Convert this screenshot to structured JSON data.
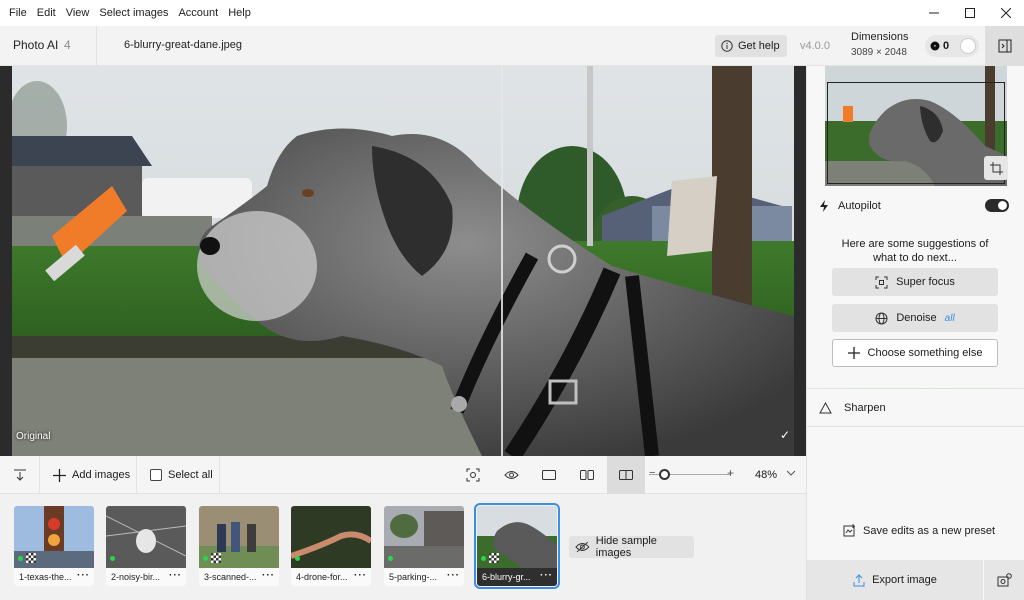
{
  "menu": [
    "File",
    "Edit",
    "View",
    "Select images",
    "Account",
    "Help"
  ],
  "header": {
    "app_name": "Photo AI",
    "app_version": "4",
    "filename": "6-blurry-great-dane.jpeg",
    "get_help": "Get help",
    "version": "v4.0.0",
    "dimensions_label": "Dimensions",
    "dimensions_value": "3089 × 2048",
    "credits": "0"
  },
  "canvas": {
    "original_label": "Original"
  },
  "toolbar": {
    "add_images": "Add images",
    "select_all": "Select all",
    "zoom_value": "48%",
    "zoom_level": 0.2
  },
  "thumbnails": [
    {
      "caption": "1-texas-the...",
      "selected": false
    },
    {
      "caption": "2-noisy-bir...",
      "selected": false
    },
    {
      "caption": "3-scanned-...",
      "selected": false
    },
    {
      "caption": "4-drone-for...",
      "selected": false
    },
    {
      "caption": "5-parking-...",
      "selected": false
    },
    {
      "caption": "6-blurry-gr...",
      "selected": true
    }
  ],
  "hide_samples": "Hide sample images",
  "panel": {
    "autopilot": "Autopilot",
    "suggestion_text": "Here are some suggestions of what to do next...",
    "super_focus": "Super focus",
    "denoise": "Denoise",
    "denoise_badge": "all",
    "choose_else": "Choose something else",
    "sharpen": "Sharpen",
    "save_preset": "Save edits as a new preset",
    "export": "Export image"
  },
  "colors": {
    "accent": "#3b8fe3",
    "active_dot": "#2cd64b"
  },
  "icons": [
    "info-icon",
    "sidebar-toggle-icon",
    "sort-icon",
    "plus-icon",
    "face-detect-icon",
    "eye-icon",
    "single-view-icon",
    "side-by-side-icon",
    "split-view-icon",
    "chevron-down-icon",
    "eye-off-icon",
    "crop-icon",
    "bolt-icon",
    "focus-icon",
    "globe-icon",
    "triangle-icon",
    "preset-icon",
    "upload-icon",
    "export-settings-icon"
  ]
}
